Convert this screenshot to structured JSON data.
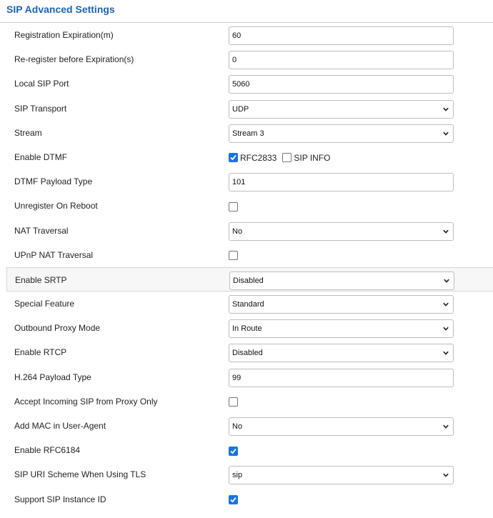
{
  "title": "SIP Advanced Settings",
  "colors": {
    "accent": "#1a64b4",
    "checkbox": "#1a73e8"
  },
  "rows": [
    {
      "label": "Registration Expiration(m)",
      "type": "text",
      "value": "60"
    },
    {
      "label": "Re-register before Expiration(s)",
      "type": "text",
      "value": "0"
    },
    {
      "label": "Local SIP Port",
      "type": "text",
      "value": "5060"
    },
    {
      "label": "SIP Transport",
      "type": "select",
      "value": "UDP"
    },
    {
      "label": "Stream",
      "type": "select",
      "value": "Stream 3"
    },
    {
      "label": "Enable DTMF",
      "type": "checks",
      "options": [
        {
          "label": "RFC2833",
          "checked": true
        },
        {
          "label": "SIP INFO",
          "checked": false
        }
      ]
    },
    {
      "label": "DTMF Payload Type",
      "type": "text",
      "value": "101"
    },
    {
      "label": "Unregister On Reboot",
      "type": "checkbox",
      "checked": false
    },
    {
      "label": "NAT Traversal",
      "type": "select",
      "value": "No"
    },
    {
      "label": "UPnP NAT Traversal",
      "type": "checkbox",
      "checked": false
    },
    {
      "label": "Enable SRTP",
      "type": "select",
      "value": "Disabled",
      "highlight": true
    },
    {
      "label": "Special Feature",
      "type": "select",
      "value": "Standard"
    },
    {
      "label": "Outbound Proxy Mode",
      "type": "select",
      "value": "In Route"
    },
    {
      "label": "Enable RTCP",
      "type": "select",
      "value": "Disabled"
    },
    {
      "label": "H.264 Payload Type",
      "type": "text",
      "value": "99"
    },
    {
      "label": "Accept Incoming SIP from Proxy Only",
      "type": "checkbox",
      "checked": false
    },
    {
      "label": "Add MAC in User-Agent",
      "type": "select",
      "value": "No"
    },
    {
      "label": "Enable RFC6184",
      "type": "checkbox",
      "checked": true
    },
    {
      "label": "SIP URI Scheme When Using TLS",
      "type": "select",
      "value": "sip"
    },
    {
      "label": "Support SIP Instance ID",
      "type": "checkbox",
      "checked": true
    }
  ]
}
